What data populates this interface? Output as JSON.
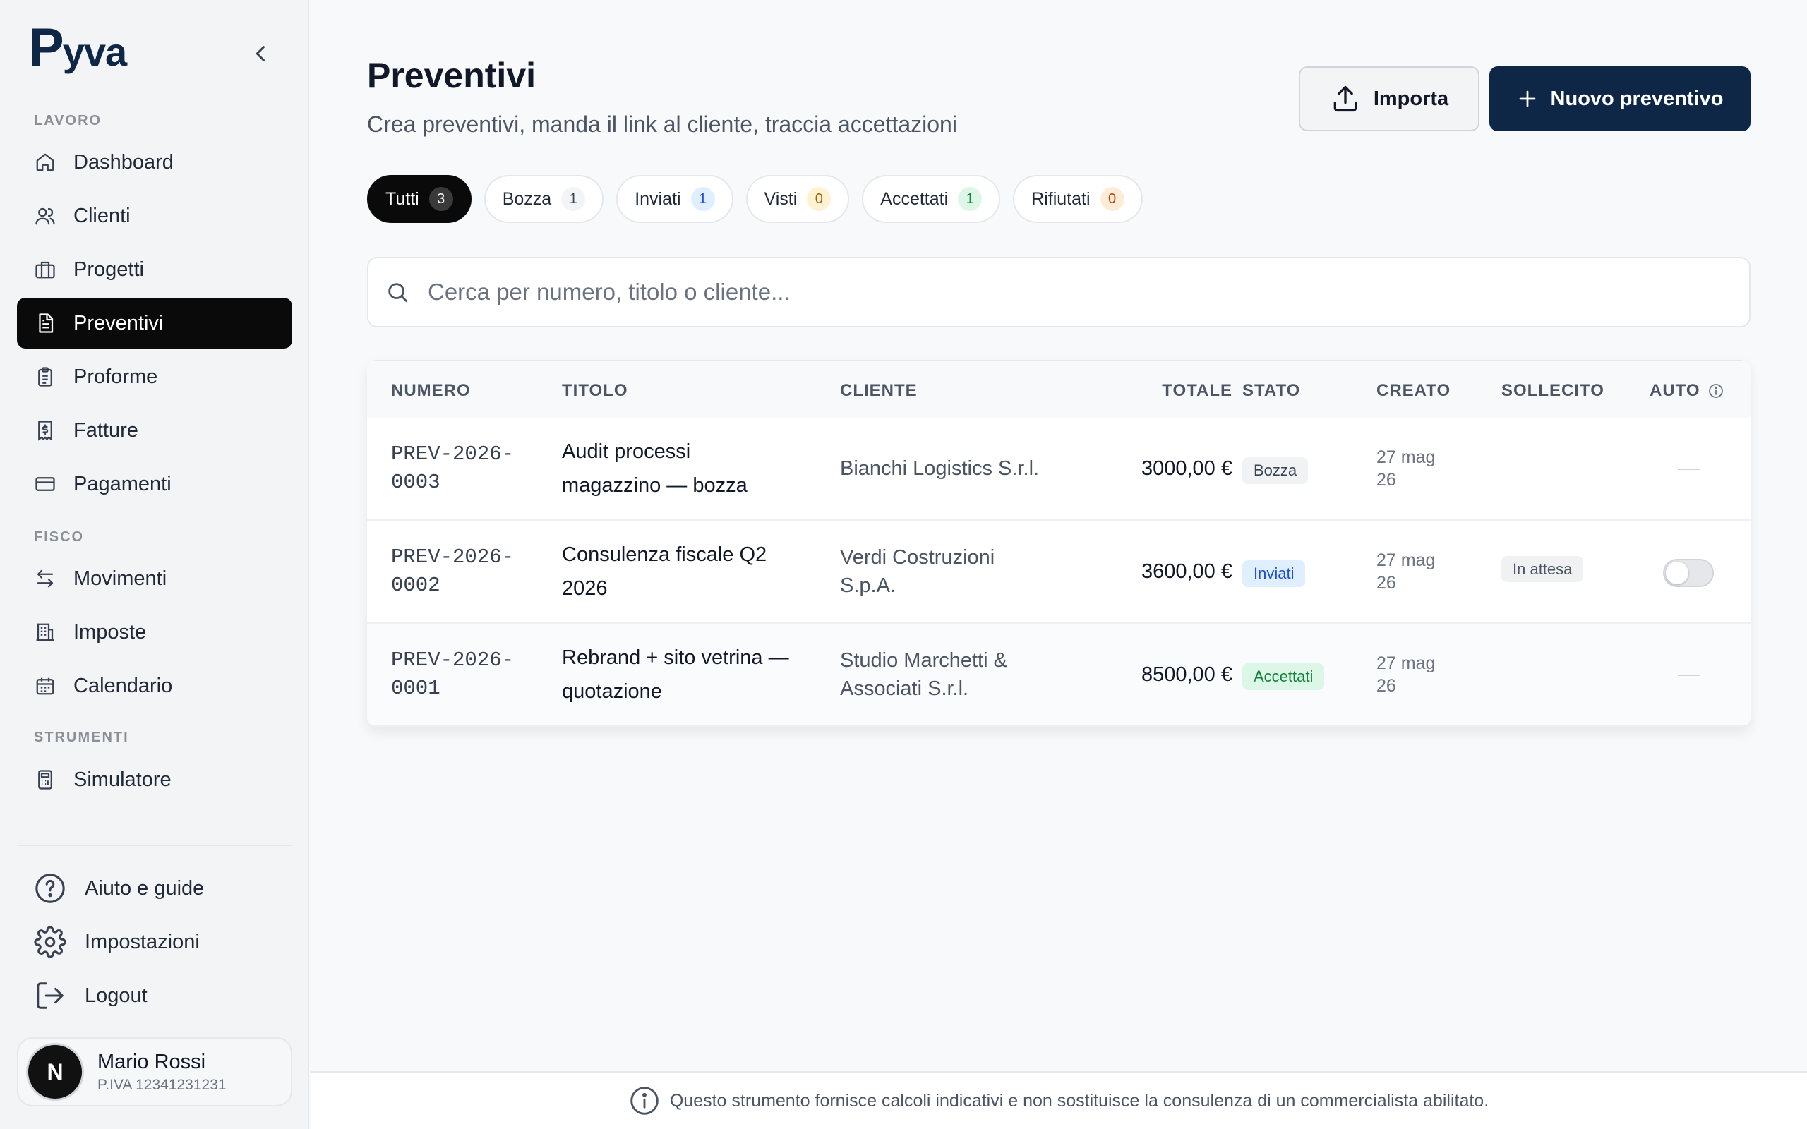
{
  "brand": {
    "logo_text": "yva",
    "logo_initial": "P"
  },
  "sidebar": {
    "sections": [
      {
        "label": "LAVORO"
      },
      {
        "label": "FISCO"
      },
      {
        "label": "STRUMENTI"
      }
    ],
    "items": [
      {
        "label": "Dashboard",
        "icon": "home-icon"
      },
      {
        "label": "Clienti",
        "icon": "users-icon"
      },
      {
        "label": "Progetti",
        "icon": "briefcase-icon"
      },
      {
        "label": "Preventivi",
        "icon": "document-icon",
        "active": true
      },
      {
        "label": "Proforme",
        "icon": "clipboard-icon"
      },
      {
        "label": "Fatture",
        "icon": "receipt-icon"
      },
      {
        "label": "Pagamenti",
        "icon": "credit-card-icon"
      },
      {
        "label": "Movimenti",
        "icon": "arrows-icon"
      },
      {
        "label": "Imposte",
        "icon": "building-icon"
      },
      {
        "label": "Calendario",
        "icon": "calendar-icon"
      },
      {
        "label": "Simulatore",
        "icon": "calculator-icon"
      }
    ],
    "bottom": [
      {
        "label": "Aiuto e guide",
        "icon": "help-icon"
      },
      {
        "label": "Impostazioni",
        "icon": "gear-icon"
      },
      {
        "label": "Logout",
        "icon": "logout-icon"
      }
    ],
    "user": {
      "avatar_initial": "N",
      "name": "Mario Rossi",
      "vat": "P.IVA 12341231231"
    }
  },
  "header": {
    "title": "Preventivi",
    "subtitle": "Crea preventivi, manda il link al cliente, traccia accettazioni",
    "import_label": "Importa",
    "new_label": "Nuovo preventivo"
  },
  "filters": [
    {
      "label": "Tutti",
      "count": "3",
      "active": true,
      "count_bg": "#3a3a3a",
      "count_color": "#ffffff"
    },
    {
      "label": "Bozza",
      "count": "1",
      "count_bg": "#f3f4f6",
      "count_color": "#374151"
    },
    {
      "label": "Inviati",
      "count": "1",
      "count_bg": "#e0efff",
      "count_color": "#1d4ed8"
    },
    {
      "label": "Visti",
      "count": "0",
      "count_bg": "#fdf3d3",
      "count_color": "#a16207"
    },
    {
      "label": "Accettati",
      "count": "1",
      "count_bg": "#dcf7e7",
      "count_color": "#15803d"
    },
    {
      "label": "Rifiutati",
      "count": "0",
      "count_bg": "#fdecd8",
      "count_color": "#c2410c"
    }
  ],
  "search": {
    "placeholder": "Cerca per numero, titolo o cliente..."
  },
  "table": {
    "headers": {
      "numero": "NUMERO",
      "titolo": "TITOLO",
      "cliente": "CLIENTE",
      "totale": "TOTALE",
      "stato": "STATO",
      "creato": "CREATO",
      "sollecito": "SOLLECITO",
      "auto": "AUTO"
    },
    "rows": [
      {
        "numero_1": "PREV-2026-",
        "numero_2": "0003",
        "titolo_1": "Audit processi",
        "titolo_2": "magazzino — bozza",
        "cliente_1": "Bianchi Logistics S.r.l.",
        "cliente_2": "",
        "totale": "3000,00 €",
        "stato": "Bozza",
        "stato_bg": "#f1f2f4",
        "stato_color": "#374151",
        "creato_1": "27 mag",
        "creato_2": "26",
        "sollecito": "",
        "auto": "none"
      },
      {
        "numero_1": "PREV-2026-",
        "numero_2": "0002",
        "titolo_1": "Consulenza fiscale Q2",
        "titolo_2": "2026",
        "cliente_1": "Verdi Costruzioni",
        "cliente_2": "S.p.A.",
        "totale": "3600,00 €",
        "stato": "Inviati",
        "stato_bg": "#e0efff",
        "stato_color": "#1d4ed8",
        "creato_1": "27 mag",
        "creato_2": "26",
        "sollecito": "In attesa",
        "auto": "toggle-off"
      },
      {
        "numero_1": "PREV-2026-",
        "numero_2": "0001",
        "titolo_1": "Rebrand + sito vetrina —",
        "titolo_2": "quotazione",
        "cliente_1": "Studio Marchetti &",
        "cliente_2": "Associati S.r.l.",
        "totale": "8500,00 €",
        "stato": "Accettati",
        "stato_bg": "#dcf7e7",
        "stato_color": "#15803d",
        "creato_1": "27 mag",
        "creato_2": "26",
        "sollecito": "",
        "auto": "none"
      }
    ]
  },
  "footer": {
    "text": "Questo strumento fornisce calcoli indicativi e non sostituisce la consulenza di un commercialista abilitato."
  },
  "colors": {
    "brand": "#0f2747",
    "active_nav": "#0a0a0a"
  }
}
